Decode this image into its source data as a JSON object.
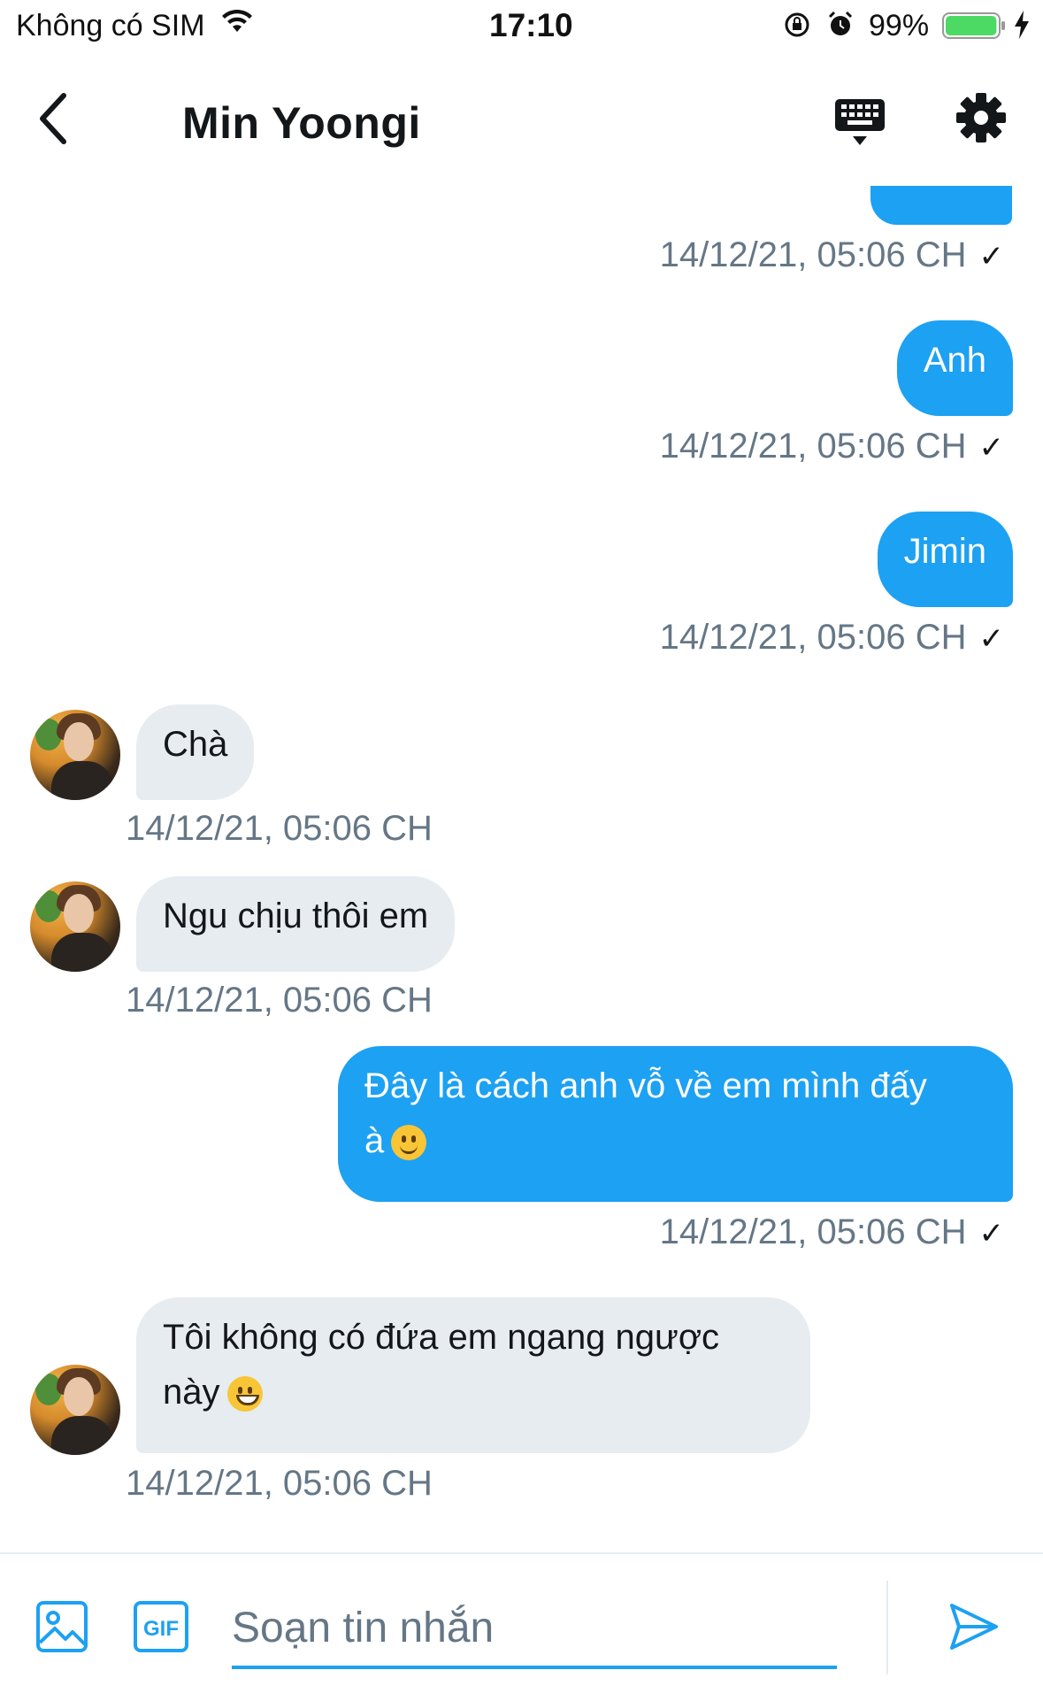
{
  "status_bar": {
    "carrier": "Không có SIM",
    "time": "17:10",
    "battery_percent": "99%",
    "battery_level": 0.99,
    "battery_color": "#4cd964"
  },
  "header": {
    "title": "Min Yoongi",
    "back_icon": "chevron-left-icon",
    "keyboard_icon": "keyboard-icon",
    "settings_icon": "gear-icon"
  },
  "colors": {
    "accent": "#1da1f2",
    "incoming_bubble": "#e6ecf0",
    "timestamp": "#657786"
  },
  "messages": [
    {
      "direction": "out",
      "text": "",
      "time": "14/12/21, 05:06 CH",
      "read_mark": "✓"
    },
    {
      "direction": "out",
      "text": "Anh",
      "time": "14/12/21, 05:06 CH",
      "read_mark": "✓"
    },
    {
      "direction": "out",
      "text": "Jimin",
      "time": "14/12/21, 05:06 CH",
      "read_mark": "✓"
    },
    {
      "direction": "in",
      "text": "Chà",
      "time": "14/12/21, 05:06 CH"
    },
    {
      "direction": "in",
      "text": "Ngu chịu thôi em",
      "time": "14/12/21, 05:06 CH"
    },
    {
      "direction": "out",
      "text": "Đây là cách anh vỗ về em mình đấy",
      "text_line2": "à",
      "emoji": "slightly-smiling-face",
      "time": "14/12/21, 05:06 CH",
      "read_mark": "✓"
    },
    {
      "direction": "in",
      "text": "Tôi không có đứa em ngang ngược",
      "text_line2": "này",
      "emoji": "grinning-face",
      "time": "14/12/21, 05:06 CH"
    }
  ],
  "composer": {
    "placeholder": "Soạn tin nhắn",
    "media_icon": "image-icon",
    "gif_label": "GIF",
    "send_icon": "send-icon"
  }
}
